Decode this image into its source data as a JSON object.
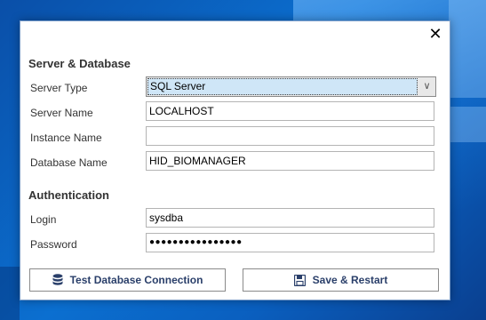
{
  "dialog": {
    "close_glyph": "✕",
    "server_section": {
      "title": "Server & Database",
      "server_type": {
        "label": "Server Type",
        "value": "SQL Server"
      },
      "server_name": {
        "label": "Server Name",
        "value": "LOCALHOST"
      },
      "instance_name": {
        "label": "Instance Name",
        "value": ""
      },
      "database_name": {
        "label": "Database Name",
        "value": "HID_BIOMANAGER"
      }
    },
    "auth_section": {
      "title": "Authentication",
      "login": {
        "label": "Login",
        "value": "sysdba"
      },
      "password": {
        "label": "Password",
        "value": "●●●●●●●●●●●●●●●●"
      }
    },
    "buttons": {
      "test_connection": {
        "label": "Test Database Connection",
        "icon": "database-icon"
      },
      "save_restart": {
        "label": "Save & Restart",
        "icon": "floppy-disk-icon"
      }
    }
  }
}
